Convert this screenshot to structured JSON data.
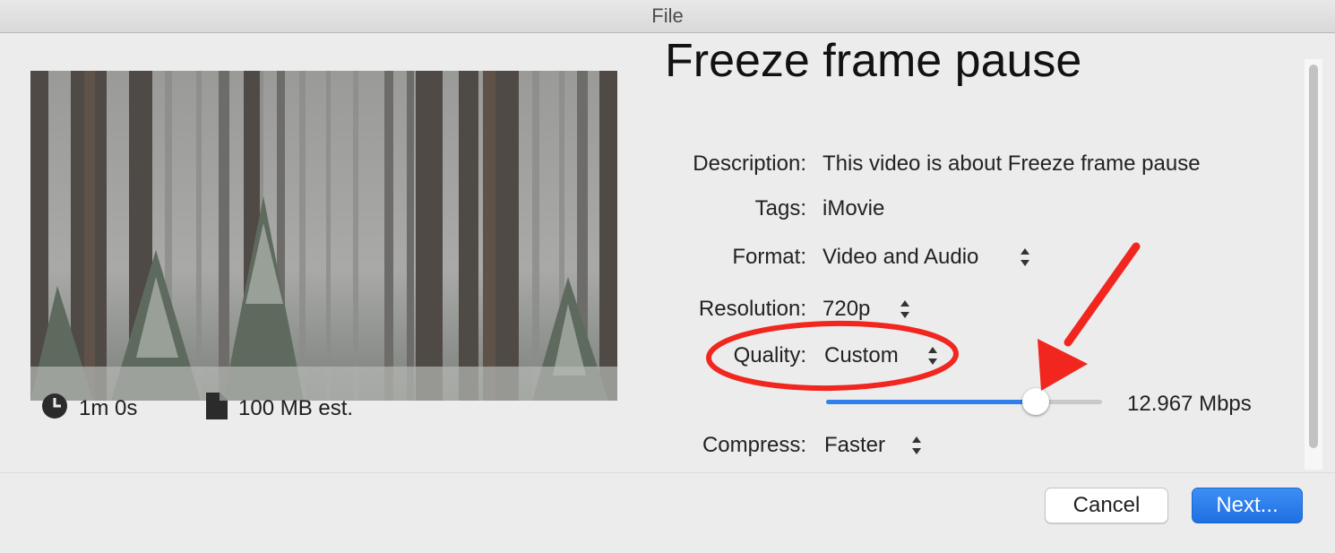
{
  "window": {
    "title": "File"
  },
  "preview": {
    "duration": "1m 0s",
    "size": "100 MB est.",
    "duration_icon": "clock-icon",
    "size_icon": "document-icon"
  },
  "details": {
    "title": "Freeze frame pause",
    "description_label": "Description:",
    "description_value": "This video is about Freeze frame pause",
    "tags_label": "Tags:",
    "tags_value": "iMovie",
    "format_label": "Format:",
    "format_value": "Video and Audio",
    "resolution_label": "Resolution:",
    "resolution_value": "720p",
    "quality_label": "Quality:",
    "quality_value": "Custom",
    "bitrate_value": "12.967 Mbps",
    "bitrate_slider_fraction": 0.76,
    "compress_label": "Compress:",
    "compress_value": "Faster"
  },
  "buttons": {
    "cancel": "Cancel",
    "next": "Next..."
  },
  "colors": {
    "accent": "#2f80ed",
    "annotation": "#f0261f"
  }
}
